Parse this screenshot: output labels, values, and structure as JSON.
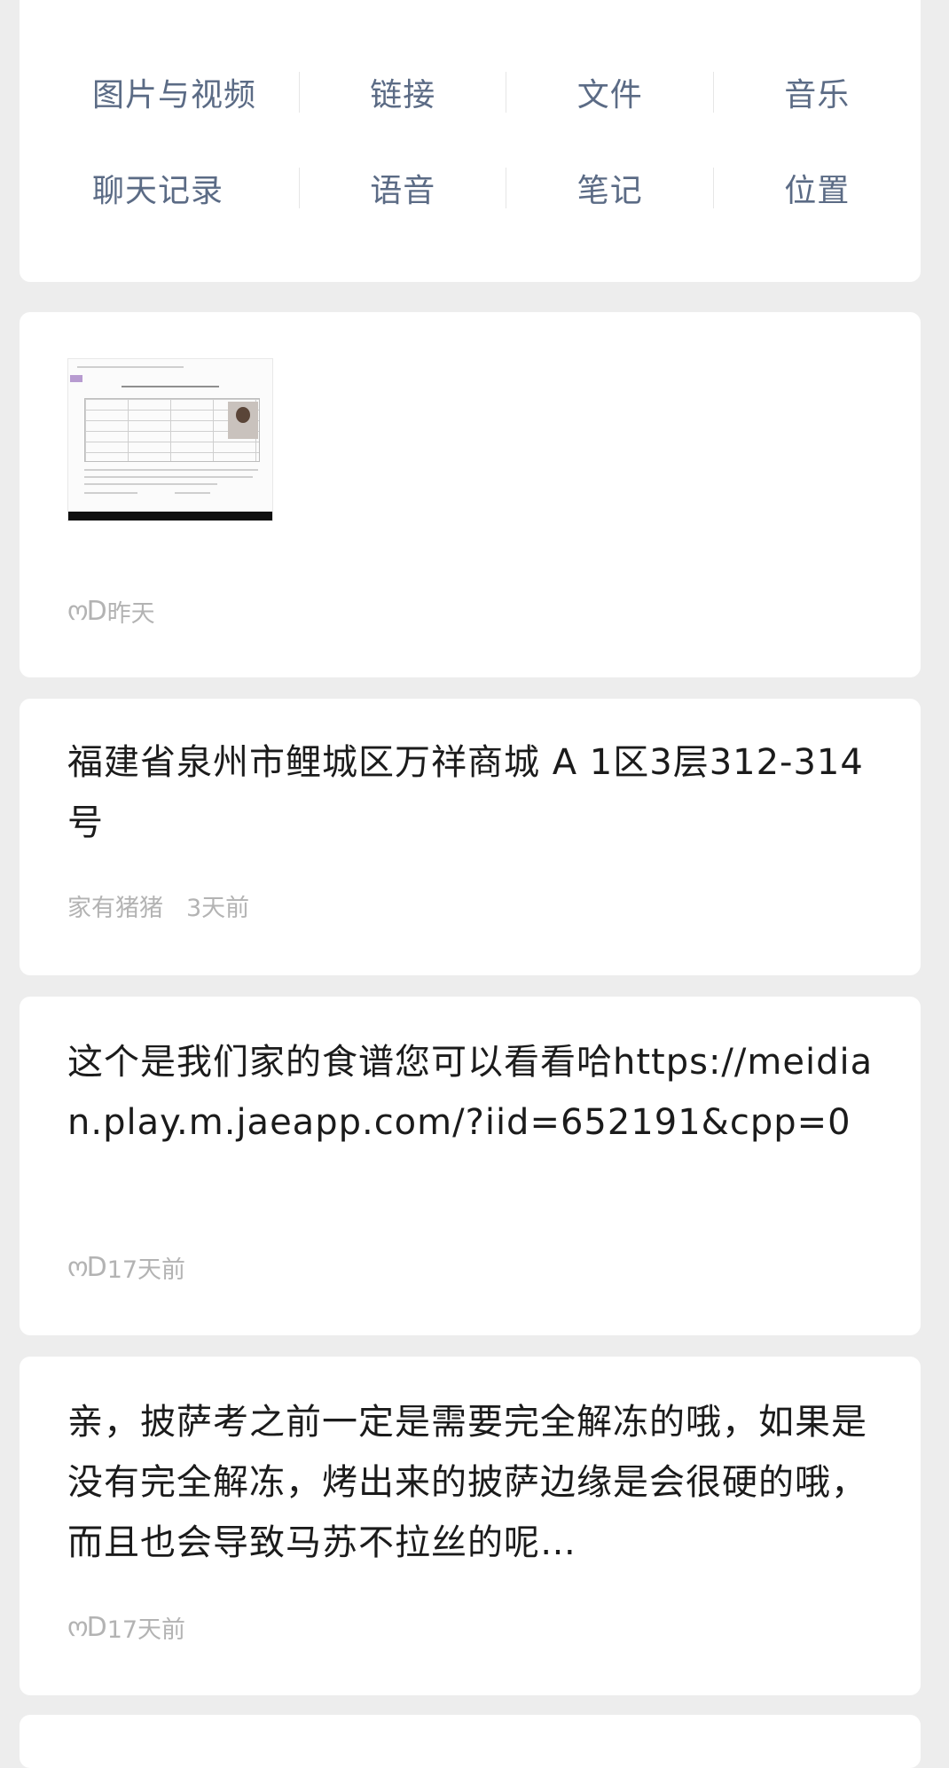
{
  "filters": [
    [
      {
        "label": "图片与视频"
      },
      {
        "label": "链接"
      },
      {
        "label": "文件"
      },
      {
        "label": "音乐"
      }
    ],
    [
      {
        "label": "聊天记录"
      },
      {
        "label": "语音"
      },
      {
        "label": "笔记"
      },
      {
        "label": "位置"
      }
    ]
  ],
  "items": [
    {
      "type": "image",
      "sender": "ოD",
      "time": "昨天"
    },
    {
      "type": "text",
      "text": "福建省泉州市鲤城区万祥商城 A 1区3层312-314号",
      "sender": "家有猪猪",
      "time": "3天前"
    },
    {
      "type": "text",
      "text": "这个是我们家的食谱您可以看看哈https://meidian.play.m.jaeapp.com/?iid=652191&cpp=0",
      "sender": "ოD",
      "time": "17天前"
    },
    {
      "type": "text",
      "text": "亲，披萨考之前一定是需要完全解冻的哦，如果是没有完全解冻，烤出来的披萨边缘是会很硬的哦，而且也会导致马苏不拉丝的呢…",
      "sender": "ოD",
      "time": "17天前"
    }
  ]
}
